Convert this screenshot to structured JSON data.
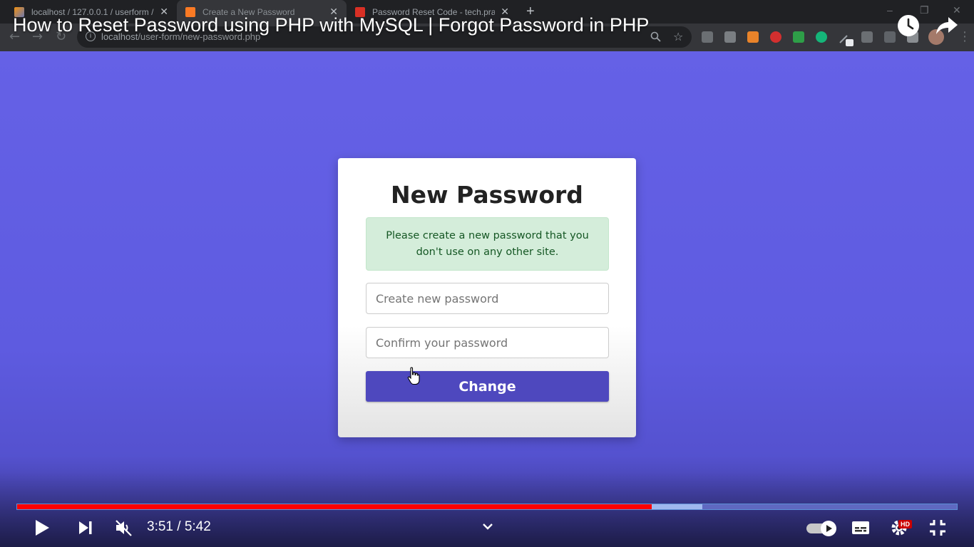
{
  "browser": {
    "tabs": [
      {
        "title": "localhost / 127.0.0.1 / userform /",
        "active": false
      },
      {
        "title": "Create a New Password",
        "active": true
      },
      {
        "title": "Password Reset Code - tech.prak",
        "active": false
      }
    ],
    "new_tab_symbol": "+",
    "url_host": "localhost",
    "url_path": "/user-form/new-password.php",
    "window_controls": [
      "–",
      "❐",
      "✕"
    ]
  },
  "video": {
    "title": "How to Reset Password using PHP with MySQL | Forgot Password in PHP",
    "current_time": "3:51",
    "duration": "5:42",
    "time_display": "3:51 / 5:42",
    "played_fraction": 0.675,
    "buffered_fraction": 0.729,
    "hd_badge": "HD",
    "progress_color": "#ff0000"
  },
  "form": {
    "title": "New Password",
    "alert": "Please create a new password that you don't use on any other site.",
    "password_placeholder": "Create new password",
    "password_value": "",
    "confirm_placeholder": "Confirm your password",
    "confirm_value": "",
    "submit_label": "Change",
    "accent_color": "#4e48be",
    "background_color": "#6561e6",
    "alert_bg": "#d4edda",
    "alert_text_color": "#155724"
  }
}
